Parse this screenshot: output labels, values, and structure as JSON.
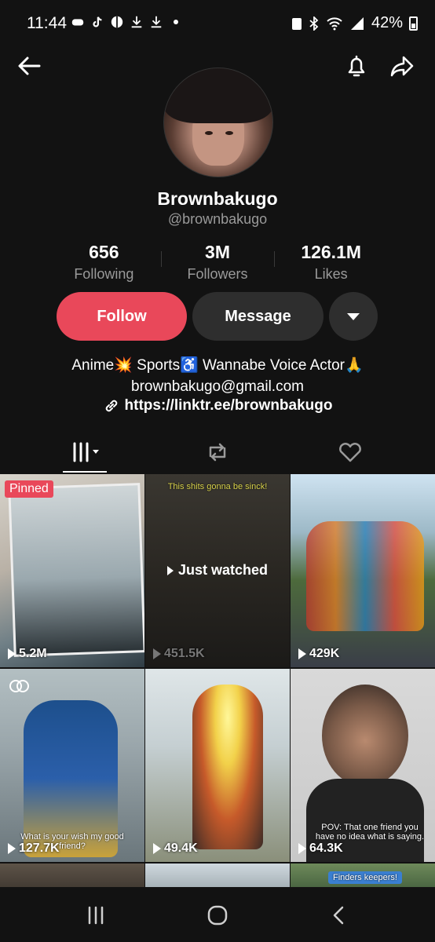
{
  "status_bar": {
    "time": "11:44",
    "battery": "42%"
  },
  "profile": {
    "name": "Brownbakugo",
    "handle": "@brownbakugo",
    "stats": [
      {
        "value": "656",
        "label": "Following"
      },
      {
        "value": "3M",
        "label": "Followers"
      },
      {
        "value": "126.1M",
        "label": "Likes"
      }
    ],
    "follow_label": "Follow",
    "message_label": "Message",
    "bio_line1": "Anime💥 Sports♿ Wannabe Voice Actor🙏",
    "bio_line2": "brownbakugo@gmail.com",
    "link": "https://linktr.ee/brownbakugo"
  },
  "videos": [
    {
      "views": "5.2M",
      "badge": "Pinned"
    },
    {
      "views": "451.5K",
      "overlay": "Just watched",
      "caption": "This shits gonna be sinck!"
    },
    {
      "views": "429K"
    },
    {
      "views": "127.7K",
      "caption": "What is your wish my good friend?"
    },
    {
      "views": "49.4K"
    },
    {
      "views": "64.3K",
      "caption": "POV: That one friend you have no idea what is saying."
    },
    {
      "views": ""
    },
    {
      "views": ""
    },
    {
      "views": "",
      "caption": "Finders keepers!"
    }
  ],
  "colors": {
    "accent": "#e9485a",
    "background": "#121212",
    "button": "#2e2e2e"
  }
}
